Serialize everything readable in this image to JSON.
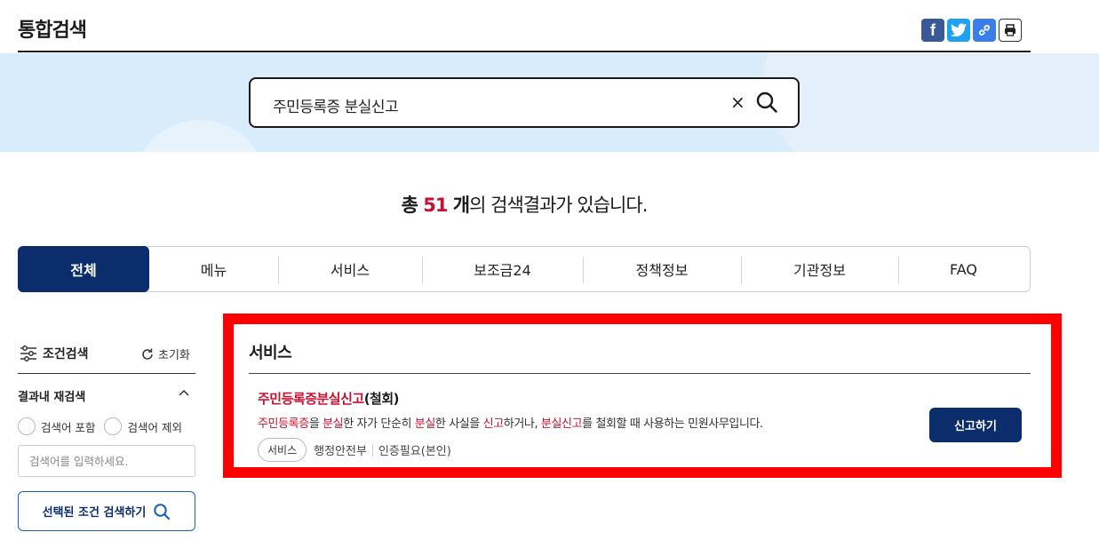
{
  "page_title": "통합검색",
  "share": {
    "facebook": "f",
    "twitter_icon": "twitter-icon",
    "link_icon": "link-icon",
    "print_icon": "print-icon"
  },
  "search": {
    "query": "주민등록증 분실신고",
    "clear_label": "×"
  },
  "summary": {
    "prefix": "총 ",
    "count": "51",
    "unit": " 개",
    "suffix": "의 검색결과가 있습니다."
  },
  "tabs": [
    {
      "label": "전체",
      "active": true
    },
    {
      "label": "메뉴"
    },
    {
      "label": "서비스"
    },
    {
      "label": "보조금24"
    },
    {
      "label": "정책정보"
    },
    {
      "label": "기관정보"
    },
    {
      "label": "FAQ"
    }
  ],
  "filter": {
    "title": "조건검색",
    "reset_label": "초기화",
    "refine_title": "결과내 재검색",
    "include_label": "검색어 포함",
    "exclude_label": "검색어 제외",
    "input_placeholder": "검색어를 입력하세요.",
    "apply_label": "선택된 조건 검색하기"
  },
  "section": {
    "title": "서비스",
    "item": {
      "title_hl": "주민등록증분실신고",
      "title_rest": "(철회)",
      "desc_parts": [
        {
          "text": "주민등록증",
          "hl": true
        },
        {
          "text": "을 ",
          "hl": false
        },
        {
          "text": "분실",
          "hl": true
        },
        {
          "text": "한 자가 단순히 ",
          "hl": false
        },
        {
          "text": "분실",
          "hl": true
        },
        {
          "text": "한 사실을 ",
          "hl": false
        },
        {
          "text": "신고",
          "hl": true
        },
        {
          "text": "하거나, ",
          "hl": false
        },
        {
          "text": "분실신고",
          "hl": true
        },
        {
          "text": "를 철회할 때 사용하는 민원사무입니다.",
          "hl": false
        }
      ],
      "chip": "서비스",
      "agency": "행정안전부",
      "auth": "인증필요(본인)",
      "action_label": "신고하기"
    }
  },
  "colors": {
    "primary": "#0b2d6b",
    "highlight_text": "#c8102e",
    "annotation_box": "#ff0000",
    "band": "#d9ecfb"
  }
}
